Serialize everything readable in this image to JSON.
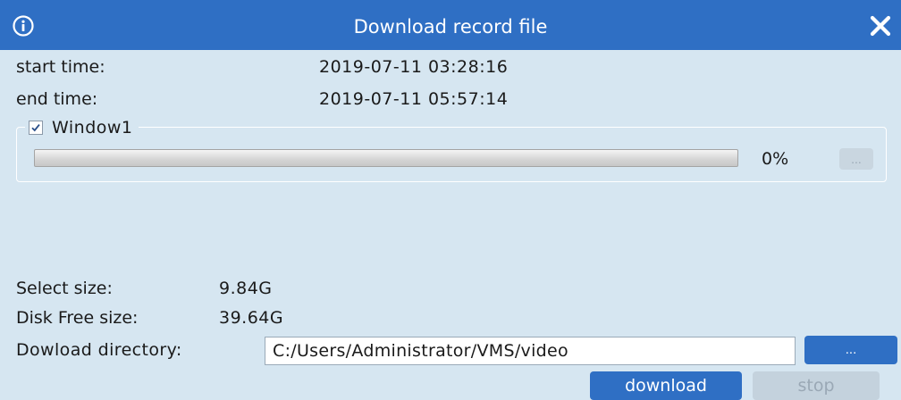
{
  "window": {
    "title": "Download record file",
    "accent_color": "#2f6fc4",
    "background_color": "#d6e6f1",
    "icons": {
      "info": "info-icon",
      "close": "close-icon"
    }
  },
  "time_range": {
    "start_label": "start time:",
    "start_value": "2019-07-11 03:28:16",
    "end_label": "end time:",
    "end_value": "2019-07-11 05:57:14"
  },
  "channels": [
    {
      "label": "Window1",
      "checked": true,
      "progress_fraction": 0,
      "progress_text": "0%",
      "browse_label": "..."
    }
  ],
  "summary": {
    "select_size_label": "Select size:",
    "select_size_value": "9.84G",
    "disk_free_label": "Disk Free size:",
    "disk_free_value": "39.64G"
  },
  "directory": {
    "label": "Dowload directory:",
    "value": "C:/Users/Administrator/VMS/video",
    "browse_label": "..."
  },
  "actions": {
    "download_label": "download",
    "stop_label": "stop",
    "stop_enabled": false
  }
}
